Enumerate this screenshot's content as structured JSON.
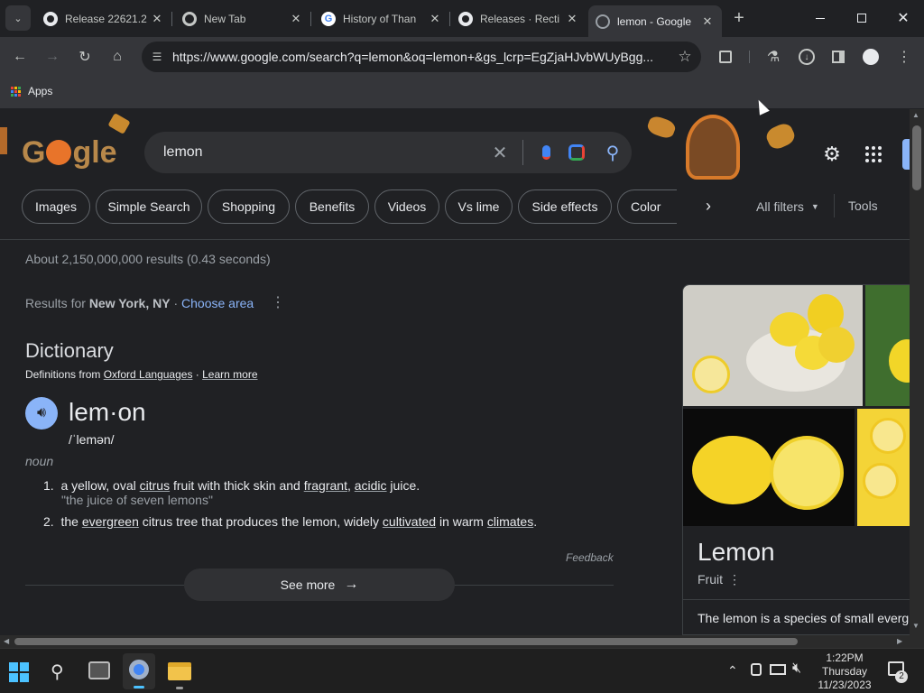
{
  "tabs": [
    {
      "title": "Release 22621.2",
      "icon": "github-icon"
    },
    {
      "title": "New Tab",
      "icon": "chrome-icon"
    },
    {
      "title": "History of Than",
      "icon": "google-icon"
    },
    {
      "title": "Releases · Recti",
      "icon": "github-icon"
    },
    {
      "title": "lemon - Google",
      "icon": "globe-icon"
    }
  ],
  "toolbar": {
    "url": "https://www.google.com/search?q=lemon&oq=lemon+&gs_lcrp=EgZjaHJvbWUyBgg..."
  },
  "bookmarks": {
    "apps": "Apps"
  },
  "search": {
    "query": "lemon",
    "logo": "Google"
  },
  "chips": [
    "Images",
    "Simple Search",
    "Shopping",
    "Benefits",
    "Videos",
    "Vs lime",
    "Side effects",
    "Color"
  ],
  "filters": {
    "all": "All filters",
    "tools": "Tools"
  },
  "stats": "About 2,150,000,000 results (0.43 seconds)",
  "location": {
    "prefix": "Results for ",
    "place": "New York, NY",
    "sep": " · ",
    "choose": "Choose area"
  },
  "dictionary": {
    "heading": "Dictionary",
    "source_prefix": "Definitions from ",
    "source": "Oxford Languages",
    "source_sep": " · ",
    "learn": "Learn more",
    "word": "lem·on",
    "phonetic": "/ˈlemən/",
    "pos": "noun",
    "def1": {
      "num": "1.",
      "a": "a yellow, oval ",
      "citrus": "citrus",
      "b": " fruit with thick skin and ",
      "fragrant": "fragrant",
      "c": ", ",
      "acidic": "acidic",
      "d": " juice.",
      "example": "\"the juice of seven lemons\""
    },
    "def2": {
      "num": "2.",
      "a": "the ",
      "evergreen": "evergreen",
      "b": " citrus tree that produces the lemon, widely ",
      "cultivated": "cultivated",
      "c": " in warm ",
      "climates": "climates",
      "d": "."
    },
    "feedback": "Feedback",
    "see_more": "See more"
  },
  "knowledge": {
    "title": "Lemon",
    "subtitle": "Fruit",
    "desc": "The lemon is a species of small everg"
  },
  "taskbar": {
    "time": "1:22PM",
    "day": "Thursday",
    "date": "11/23/2023",
    "notif": "2"
  },
  "colors": {
    "accent": "#8ab4f8",
    "bg": "#202124",
    "surface": "#303134",
    "lemon": "#f5d327"
  }
}
